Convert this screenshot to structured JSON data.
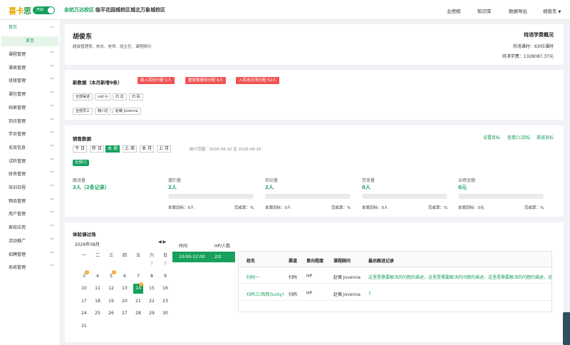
{
  "topbar": {
    "logo_part1": "喜卡",
    "logo_part2": "思",
    "toggle_label": "开启",
    "campuses": [
      "余杭万达校区",
      "临平花园城校区",
      "城北万象城校区"
    ],
    "nav": [
      "业绩榜",
      "知识库",
      "数据导出",
      "胡俊东"
    ]
  },
  "sidebar": {
    "top": "首页",
    "sub": "首页",
    "items": [
      "课程管理",
      "课表管理",
      "班级管理",
      "课包管理",
      "线索管理",
      "到访管理",
      "学员管理",
      "无效信息",
      "试听管理",
      "财务管理",
      "培训日程",
      "物品管理",
      "用户管理",
      "家校应用",
      "活动推广",
      "招聘管理",
      "系统管理"
    ]
  },
  "profile": {
    "name": "胡俊东",
    "roles": "超级管理员、校长、老师、班主任、课程顾问",
    "pending_title": "待消学费概况",
    "pending_hours": "待消课时：6305课时",
    "pending_fee": "待消学费：1328087.37元"
  },
  "new_data": {
    "title": "新数据（本月新增9条）",
    "tags": [
      "新入库待分配 1人",
      "重复数据待分配 6人",
      "入库未日清分配 52人"
    ],
    "chips_row1": [
      "全部渠道",
      "call in",
      "扫 访",
      "扫 码"
    ],
    "chips_row2": [
      "全部员工",
      "韩川达",
      "赵薇 Jovenna"
    ]
  },
  "sales": {
    "title": "销售数据",
    "links": [
      "设置目标",
      "查看CC目标",
      "渠道目标"
    ],
    "tabs": [
      "今 日",
      "昨 日",
      "本 周",
      "上 周",
      "本 月",
      "上 月"
    ],
    "active_tab": 2,
    "range": "统计范围：2026-08-10 至 2026-08-16",
    "cc_chip": "全部CC",
    "stats": [
      {
        "label": "跟进量",
        "value": "2人（2条记录）",
        "progress": 0,
        "target": "",
        "rate": ""
      },
      {
        "label": "邀约量",
        "value": "2人",
        "progress": 0,
        "target": "本周目标：0人",
        "rate": "完成率：%"
      },
      {
        "label": "到访量",
        "value": "2人",
        "progress": 0,
        "target": "本周目标：0人",
        "rate": "完成率：%"
      },
      {
        "label": "签单量",
        "value": "0人",
        "progress": 0,
        "target": "本周目标：0人",
        "rate": "完成率：%"
      },
      {
        "label": "业绩金额",
        "value": "0元",
        "progress": 0,
        "target": "本周目标：0元",
        "rate": "完成率：%"
      }
    ]
  },
  "trial": {
    "title": "体验课过场",
    "month": "2026年08月",
    "arrows": "◀ ▶",
    "weekdays": [
      "一",
      "二",
      "三",
      "四",
      "五",
      "六",
      "日"
    ],
    "days": [
      [
        "",
        "",
        "",
        "",
        "",
        "1",
        "2"
      ],
      [
        "3",
        "4",
        "5",
        "6",
        "7",
        "8",
        "9"
      ],
      [
        "10",
        "11",
        "12",
        "13",
        "14",
        "15",
        "16"
      ],
      [
        "17",
        "18",
        "19",
        "20",
        "21",
        "22",
        "23"
      ],
      [
        "24",
        "25",
        "26",
        "27",
        "28",
        "29",
        "30"
      ],
      [
        "31",
        "",
        "",
        "",
        "",
        "",
        ""
      ]
    ],
    "badges": {
      "3": "2",
      "5": "2",
      "14": "2"
    },
    "selected_day": "14",
    "slot_headers": [
      "时间",
      "HP/人数"
    ],
    "slot": {
      "time": "10:00-12:00",
      "count": "2/2"
    },
    "table_headers": [
      "姓名",
      "渠道",
      "意向程度",
      "课程顾问",
      "最后跟进记录"
    ],
    "rows": [
      {
        "name": "扫码一",
        "channel": "扫码",
        "level": "HP",
        "advisor": "赵薇 Jovenna",
        "record": "这里是需要解决的问题的描述，这里是需要解决的问题的描述，这里是需要解决的问题的描述，这里是需要解决的问题的描述"
      },
      {
        "name": "扫码三(西西/lucky)",
        "channel": "扫码",
        "level": "HP",
        "advisor": "赵薇 Jovenna",
        "record": "1"
      }
    ]
  }
}
